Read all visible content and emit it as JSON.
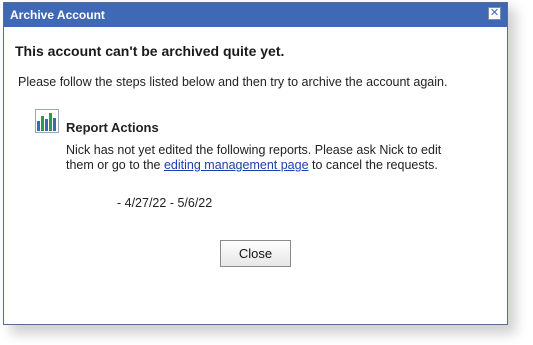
{
  "dialog": {
    "title": "Archive Account",
    "close_icon": "close-icon",
    "heading": "This account can't be archived quite yet.",
    "instruction": "Please follow the steps listed below and then try to archive the account again."
  },
  "report_actions": {
    "icon": "bar-chart-icon",
    "title": "Report Actions",
    "message_before": "Nick has not yet edited the following reports. Please ask Nick to edit them or go to the ",
    "link_text": "editing management page",
    "message_after": " to cancel the requests.",
    "date_range": "- 4/27/22 - 5/6/22"
  },
  "buttons": {
    "close_label": "Close"
  },
  "colors": {
    "titlebar": "#3f69b4",
    "link": "#1a3fb0"
  }
}
